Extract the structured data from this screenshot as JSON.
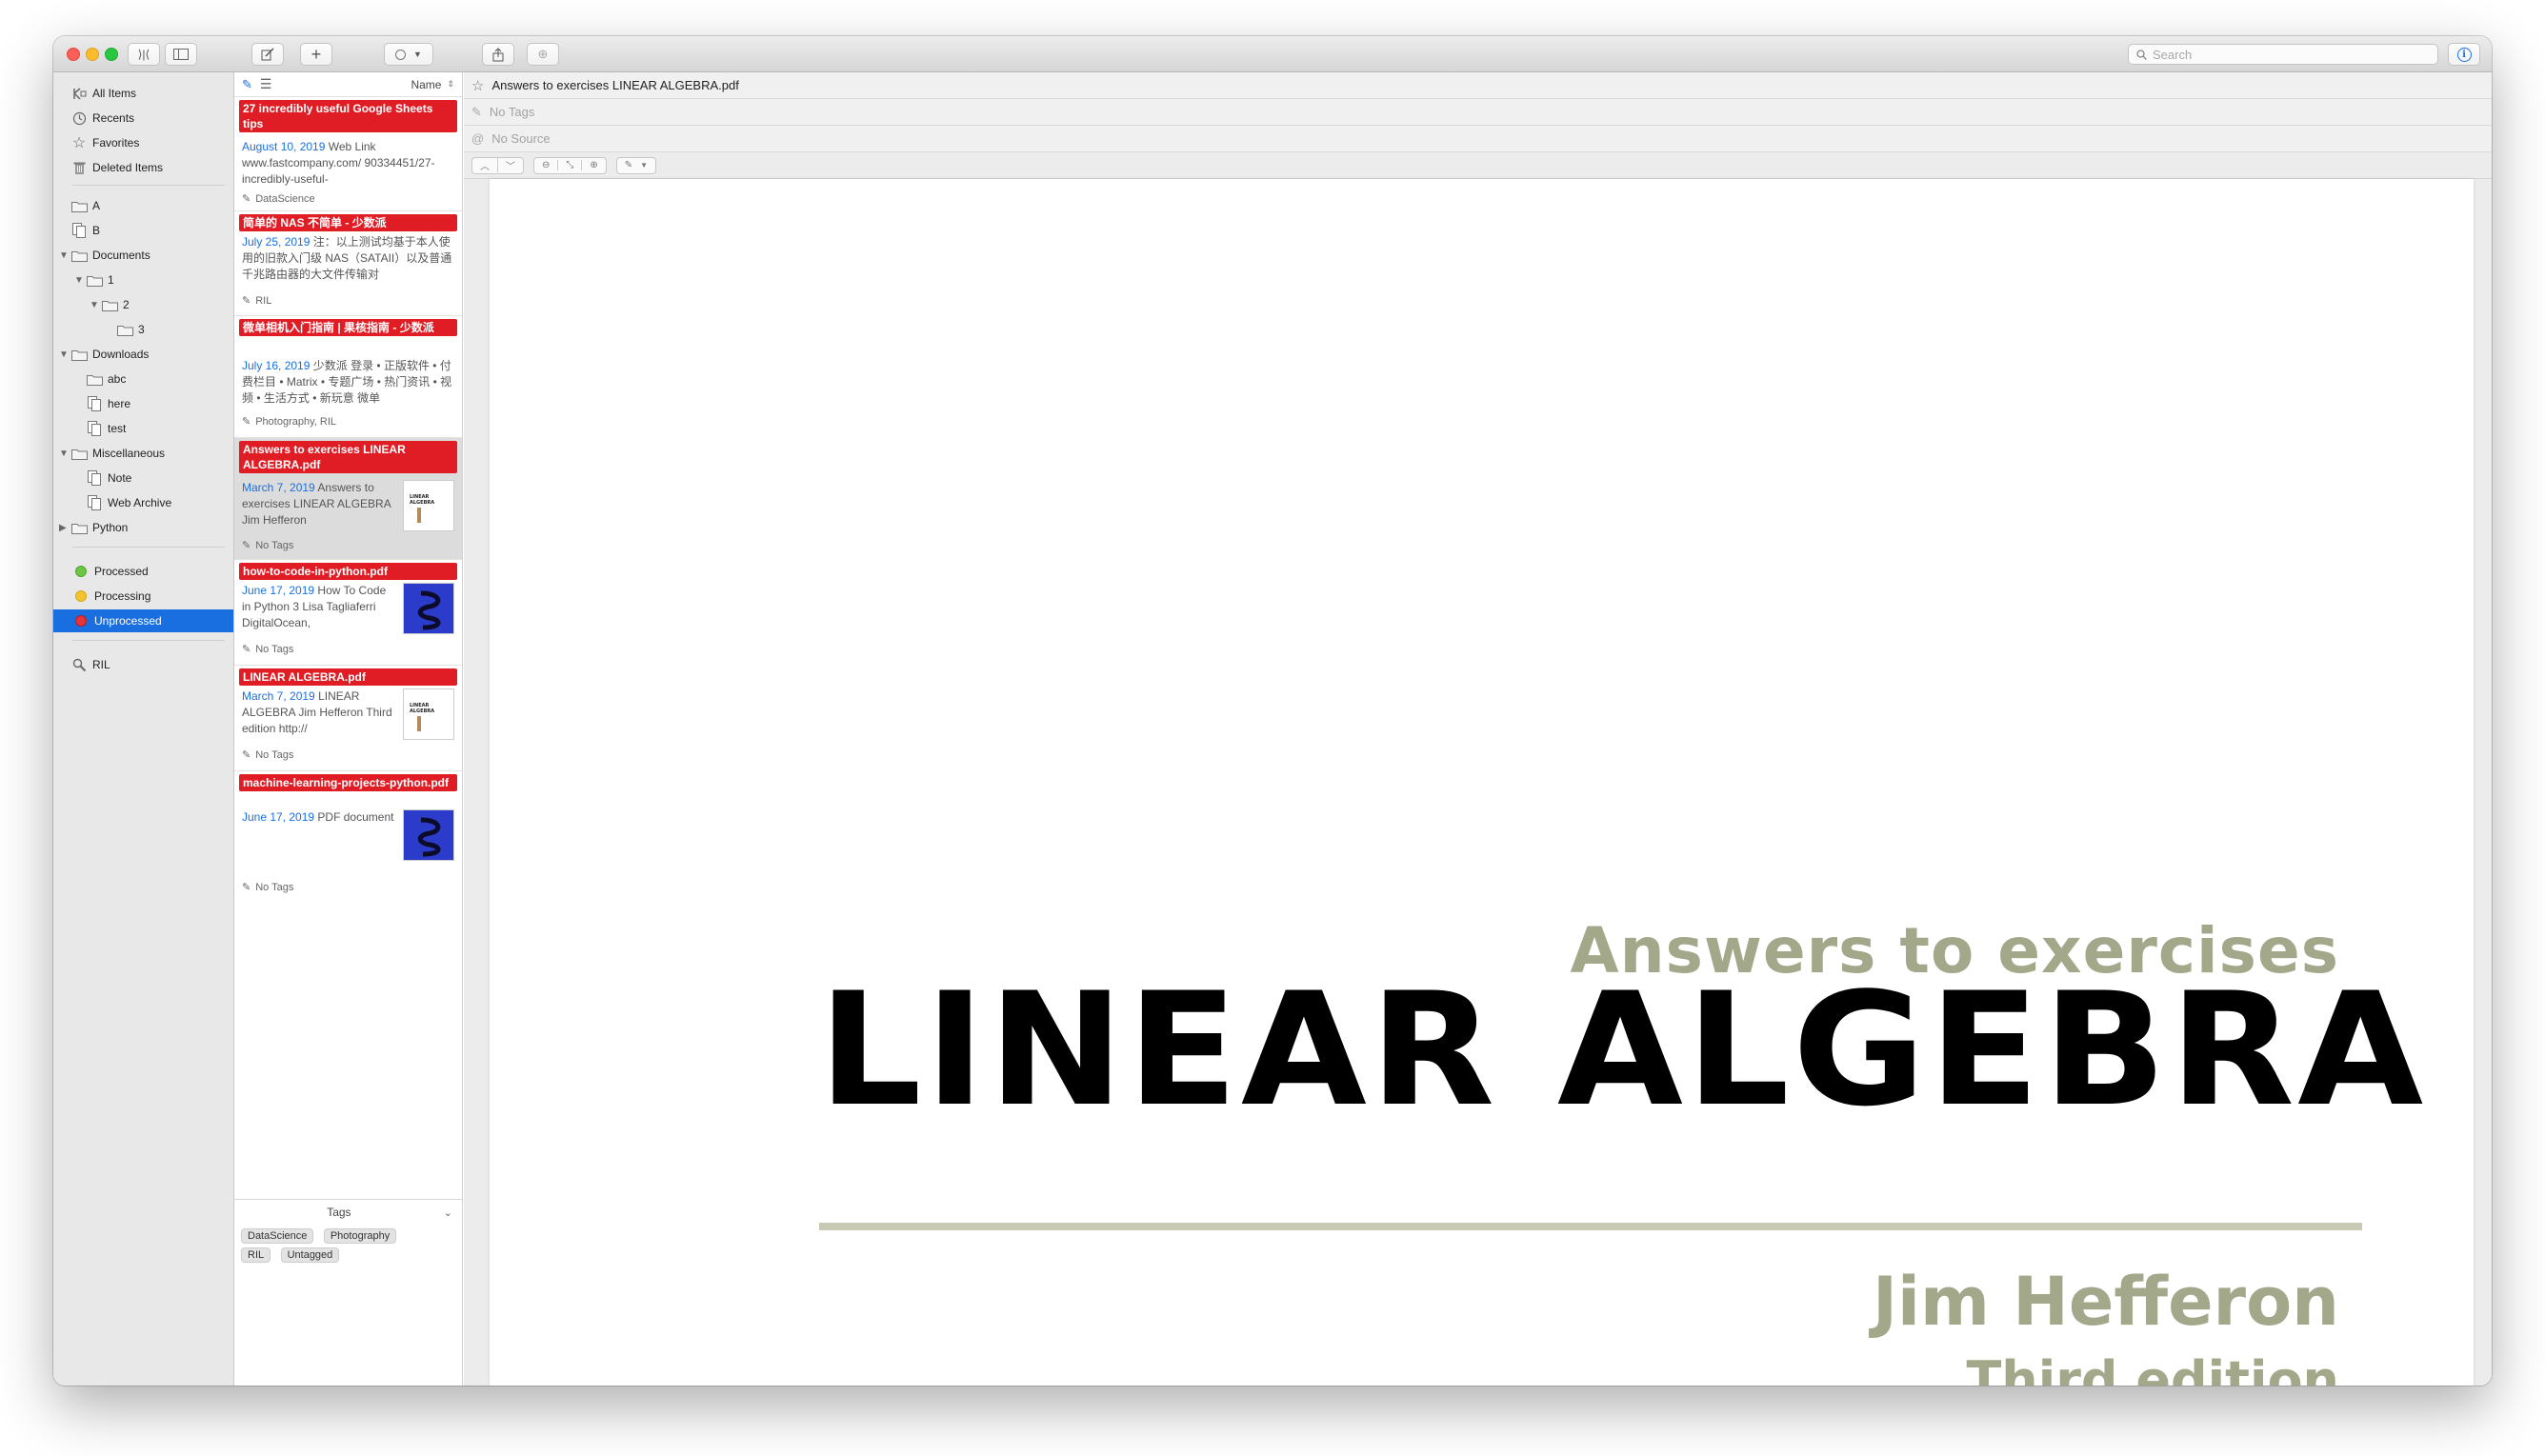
{
  "search": {
    "placeholder": "Search"
  },
  "sidebar": {
    "smart": [
      {
        "label": "All Items",
        "icon": "all-items-icon"
      },
      {
        "label": "Recents",
        "icon": "clock-icon"
      },
      {
        "label": "Favorites",
        "icon": "star-icon"
      },
      {
        "label": "Deleted Items",
        "icon": "trash-icon"
      }
    ],
    "folders": [
      {
        "label": "A",
        "depth": 0,
        "icon": "folder-icon"
      },
      {
        "label": "B",
        "depth": 0,
        "icon": "group-icon"
      },
      {
        "label": "Documents",
        "depth": 0,
        "icon": "folder-icon",
        "expanded": true
      },
      {
        "label": "1",
        "depth": 1,
        "icon": "folder-icon",
        "expanded": true
      },
      {
        "label": "2",
        "depth": 2,
        "icon": "folder-icon",
        "expanded": true
      },
      {
        "label": "3",
        "depth": 3,
        "icon": "folder-icon"
      },
      {
        "label": "Downloads",
        "depth": 0,
        "icon": "folder-icon",
        "expanded": true
      },
      {
        "label": "abc",
        "depth": 1,
        "icon": "folder-icon"
      },
      {
        "label": "here",
        "depth": 1,
        "icon": "group-icon"
      },
      {
        "label": "test",
        "depth": 1,
        "icon": "group-icon"
      },
      {
        "label": "Miscellaneous",
        "depth": 0,
        "icon": "folder-icon",
        "expanded": true
      },
      {
        "label": "Note",
        "depth": 1,
        "icon": "group-icon"
      },
      {
        "label": "Web Archive",
        "depth": 1,
        "icon": "group-icon"
      },
      {
        "label": "Python",
        "depth": 0,
        "icon": "folder-icon",
        "expanded": false
      }
    ],
    "statuses": [
      {
        "label": "Processed",
        "color": "#6cc644"
      },
      {
        "label": "Processing",
        "color": "#f4c430"
      },
      {
        "label": "Unprocessed",
        "color": "#e5343a"
      }
    ],
    "saved_search": {
      "label": "RIL",
      "icon": "magnifier-icon"
    }
  },
  "list": {
    "sort_label": "Name",
    "items": [
      {
        "title": "27 incredibly useful Google Sheets tips",
        "date": "August 10, 2019",
        "summary": "Web Link www.fastcompany.com/ 90334451/27-incredibly-useful-",
        "tags": "DataScience",
        "thumb": null
      },
      {
        "title": "简单的 NAS 不简单 - 少数派",
        "date": "July 25, 2019",
        "summary": "注：以上测试均基于本人使用的旧款入门级 NAS（SATAII）以及普通千兆路由器的大文件传输对",
        "tags": "RIL",
        "thumb": null
      },
      {
        "title": "微单相机入门指南 | 果核指南 - 少数派",
        "date": "July 16, 2019",
        "summary": "少数派 登录 • 正版软件 • 付费栏目 • Matrix • 专题广场 • 热门资讯 • 视频 • 生活方式 • 新玩意 微单",
        "tags": "Photography, RIL",
        "thumb": null
      },
      {
        "title": "Answers to exercises LINEAR ALGEBRA.pdf",
        "date": "March 7, 2019",
        "summary": "Answers to exercises LINEAR ALGEBRA Jim Hefferon",
        "tags": "No Tags",
        "thumb": "linear"
      },
      {
        "title": "how-to-code-in-python.pdf",
        "date": "June 17, 2019",
        "summary": "How To Code in Python 3 Lisa Tagliaferri DigitalOcean,",
        "tags": "No Tags",
        "thumb": "python"
      },
      {
        "title": "LINEAR ALGEBRA.pdf",
        "date": "March 7, 2019",
        "summary": "LINEAR ALGEBRA Jim Hefferon Third edition http://",
        "tags": "No Tags",
        "thumb": "linear"
      },
      {
        "title": "machine-learning-projects-python.pdf",
        "date": "June 17, 2019",
        "summary": "PDF document",
        "tags": "No Tags",
        "thumb": "python"
      }
    ],
    "tags_panel": {
      "header": "Tags",
      "chips": [
        "DataScience",
        "Photography",
        "RIL",
        "Untagged"
      ]
    }
  },
  "detail": {
    "title": "Answers to exercises LINEAR ALGEBRA.pdf",
    "tags_placeholder": "No Tags",
    "source_placeholder": "No Source"
  },
  "pdf": {
    "subtitle": "Answers to exercises",
    "title": "LINEAR ALGEBRA",
    "author": "Jim Hefferon",
    "edition": "Third edition"
  },
  "thumbs": {
    "linear_caption": "LINEAR ALGEBRA"
  }
}
